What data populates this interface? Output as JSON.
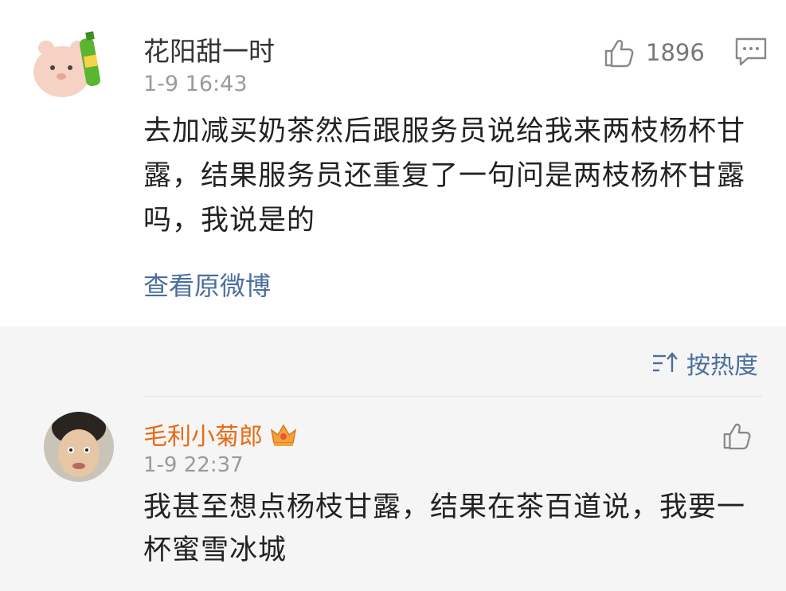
{
  "post": {
    "username": "花阳甜一时",
    "timestamp": "1-9 16:43",
    "like_count": "1896",
    "text": "去加减买奶茶然后跟服务员说给我来两枝杨杯甘露，结果服务员还重复了一句问是两枝杨杯甘露吗，我说是的",
    "view_original_label": "查看原微博"
  },
  "comments_section": {
    "sort_label": "按热度",
    "items": [
      {
        "username": "毛利小菊郎",
        "timestamp": "1-9 22:37",
        "text": "我甚至想点杨枝甘露，结果在茶百道说，我要一杯蜜雪冰城"
      }
    ]
  },
  "colors": {
    "link_blue": "#4a6e9e",
    "vip_orange": "#e86b17",
    "comments_bg": "#f5f5f5"
  },
  "icons": {
    "like": "thumbs-up-icon",
    "comment": "comment-icon",
    "sort": "sort-icon",
    "vip": "crown-icon"
  }
}
